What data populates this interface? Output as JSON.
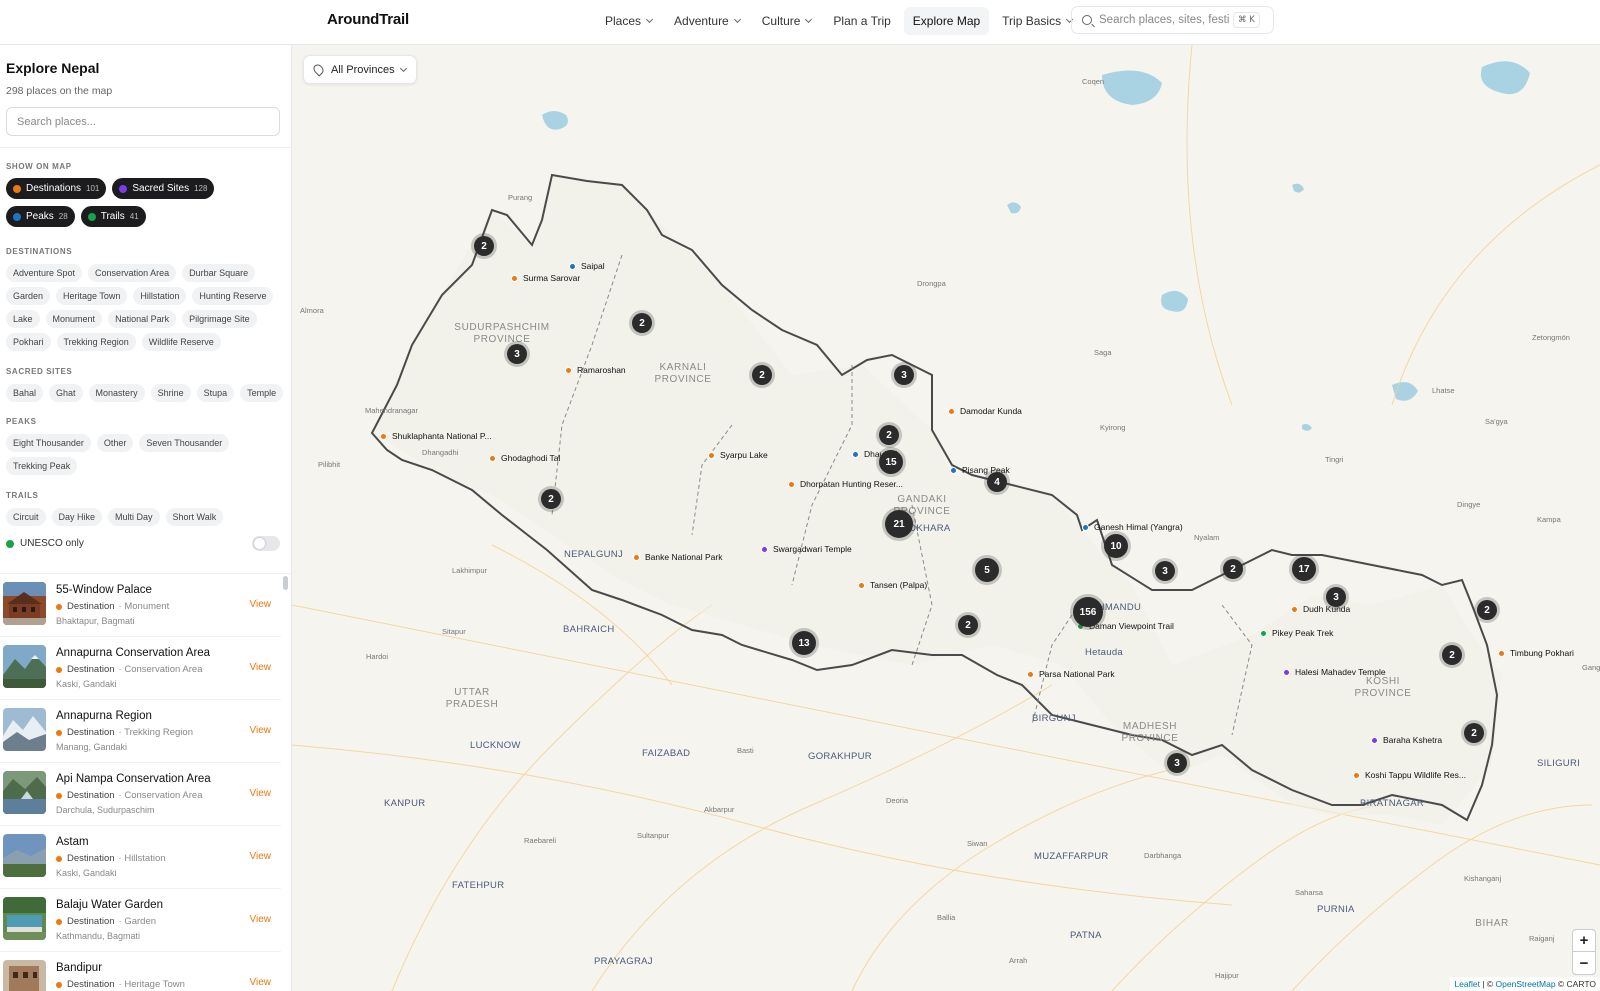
{
  "header": {
    "brand": "AroundTrail",
    "nav": [
      {
        "label": "Places",
        "dropdown": true
      },
      {
        "label": "Adventure",
        "dropdown": true
      },
      {
        "label": "Culture",
        "dropdown": true
      },
      {
        "label": "Plan a Trip",
        "dropdown": false
      },
      {
        "label": "Explore Map",
        "dropdown": false,
        "active": true
      },
      {
        "label": "Trip Basics",
        "dropdown": true
      }
    ],
    "search_placeholder": "Search places, sites, festiva",
    "search_shortcut": "⌘ K"
  },
  "sidebar": {
    "title": "Explore Nepal",
    "subtitle": "298 places on the map",
    "search_placeholder": "Search places...",
    "show_on_map_label": "SHOW ON MAP",
    "layers": [
      {
        "label": "Destinations",
        "count": "101",
        "color": "#ea7a10"
      },
      {
        "label": "Sacred Sites",
        "count": "128",
        "color": "#7c3aed"
      },
      {
        "label": "Peaks",
        "count": "28",
        "color": "#1d74c4"
      },
      {
        "label": "Trails",
        "count": "41",
        "color": "#16a34a"
      }
    ],
    "filter_groups": [
      {
        "label": "DESTINATIONS",
        "chips": [
          "Adventure Spot",
          "Conservation Area",
          "Durbar Square",
          "Garden",
          "Heritage Town",
          "Hillstation",
          "Hunting Reserve",
          "Lake",
          "Monument",
          "National Park",
          "Pilgrimage Site",
          "Pokhari",
          "Trekking Region",
          "Wildlife Reserve"
        ]
      },
      {
        "label": "SACRED SITES",
        "chips": [
          "Bahal",
          "Ghat",
          "Monastery",
          "Shrine",
          "Stupa",
          "Temple"
        ]
      },
      {
        "label": "PEAKS",
        "chips": [
          "Eight Thousander",
          "Other",
          "Seven Thousander",
          "Trekking Peak"
        ]
      },
      {
        "label": "TRAILS",
        "chips": [
          "Circuit",
          "Day Hike",
          "Multi Day",
          "Short Walk"
        ]
      }
    ],
    "unesco_label": "UNESCO only",
    "unesco_enabled": false,
    "places": [
      {
        "name": "55-Window Palace",
        "type": "Destination",
        "subtype": "· Monument",
        "location": "Bhaktapur, Bagmati",
        "action": "View"
      },
      {
        "name": "Annapurna Conservation Area",
        "type": "Destination",
        "subtype": "· Conservation Area",
        "location": "Kaski, Gandaki",
        "action": "View"
      },
      {
        "name": "Annapurna Region",
        "type": "Destination",
        "subtype": "· Trekking Region",
        "location": "Manang, Gandaki",
        "action": "View"
      },
      {
        "name": "Api Nampa Conservation Area",
        "type": "Destination",
        "subtype": "· Conservation Area",
        "location": "Darchula, Sudurpaschim",
        "action": "View"
      },
      {
        "name": "Astam",
        "type": "Destination",
        "subtype": "· Hillstation",
        "location": "Kaski, Gandaki",
        "action": "View"
      },
      {
        "name": "Balaju Water Garden",
        "type": "Destination",
        "subtype": "· Garden",
        "location": "Kathmandu, Bagmati",
        "action": "View"
      },
      {
        "name": "Bandipur",
        "type": "Destination",
        "subtype": "· Heritage Town",
        "location": "",
        "action": "View"
      }
    ]
  },
  "map": {
    "province_select": "All Provinces",
    "clusters": [
      "2",
      "2",
      "3",
      "2",
      "3",
      "2",
      "15",
      "4",
      "21",
      "2",
      "10",
      "3",
      "2",
      "17",
      "3",
      "2",
      "5",
      "156",
      "2",
      "13",
      "2",
      "2",
      "3"
    ],
    "pois": [
      {
        "label": "Saipal",
        "color": "#1d74c4"
      },
      {
        "label": "Surma Sarovar",
        "color": "#ea7a10"
      },
      {
        "label": "Ramaroshan",
        "color": "#ea7a10"
      },
      {
        "label": "Damodar Kunda",
        "color": "#ea7a10"
      },
      {
        "label": "Shuklaphanta National P...",
        "color": "#ea7a10"
      },
      {
        "label": "Ghodaghodi Tal",
        "color": "#ea7a10"
      },
      {
        "label": "Syarpu Lake",
        "color": "#ea7a10"
      },
      {
        "label": "Dhaulagi",
        "color": "#1d74c4"
      },
      {
        "label": "Pisang Peak",
        "color": "#1d74c4"
      },
      {
        "label": "Dhorpatan Hunting Reser...",
        "color": "#ea7a10"
      },
      {
        "label": "Ganesh Himal (Yangra)",
        "color": "#1d74c4"
      },
      {
        "label": "Banke National Park",
        "color": "#ea7a10"
      },
      {
        "label": "Swargadwari Temple",
        "color": "#7c3aed"
      },
      {
        "label": "Tansen (Palpa)",
        "color": "#ea7a10"
      },
      {
        "label": "Dudh Kunda",
        "color": "#ea7a10"
      },
      {
        "label": "Daman Viewpoint Trail",
        "color": "#16a34a"
      },
      {
        "label": "Pikey Peak Trek",
        "color": "#16a34a"
      },
      {
        "label": "Timbung Pokhari",
        "color": "#ea7a10"
      },
      {
        "label": "Halesi Mahadev Temple",
        "color": "#7c3aed"
      },
      {
        "label": "Parsa National Park",
        "color": "#ea7a10"
      },
      {
        "label": "Baraha Kshetra",
        "color": "#7c3aed"
      },
      {
        "label": "Koshi Tappu Wildlife Res...",
        "color": "#ea7a10"
      }
    ],
    "province_labels": [
      "SUDURPASHCHIM PROVINCE",
      "KARNALI PROVINCE",
      "GANDAKI PROVINCE",
      "KOSHI PROVINCE",
      "MADHESH PROVINCE"
    ],
    "region_labels": [
      "UTTAR PRADESH",
      "BIHAR"
    ],
    "city_labels": [
      "NEPALGUNJ",
      "BAHRAICH",
      "LUCKNOW",
      "KANPUR",
      "FAIZABAD",
      "GORAKHPUR",
      "MUZAFFARPUR",
      "PATNA",
      "BIRGUNJ",
      "BIRATNAGAR",
      "SILIGURI",
      "PURNIA",
      "PRAYAGRAJ",
      "FATEHPUR",
      "KATHMANDU",
      "Hetauda",
      "POKHARA"
    ],
    "place_labels": [
      "Purang",
      "Coqen",
      "Drongpa",
      "Saga",
      "Almora",
      "Kyirong",
      "Tingri",
      "Lhatse",
      "Sa'gya",
      "Zetongmön",
      "Dingye",
      "Nyalam",
      "Kampa",
      "Gangtok",
      "Pilibhit",
      "Dhangadhi",
      "Lakhimpur",
      "Sitapur",
      "Hardoi",
      "Mahendranagar",
      "Basti",
      "Akbarpur",
      "Raebareli",
      "Sultanpur",
      "Deoria",
      "Siwan",
      "Darbhanga",
      "Saharsa",
      "Kishanganj",
      "Raiganj",
      "Ballia",
      "Arrah",
      "Hajipur"
    ],
    "zoom_in": "+",
    "zoom_out": "−",
    "attribution_leaflet": "Leaflet",
    "attribution_sep": " | © ",
    "attribution_osm": "OpenStreetMap",
    "attribution_tail": " © CARTO"
  }
}
